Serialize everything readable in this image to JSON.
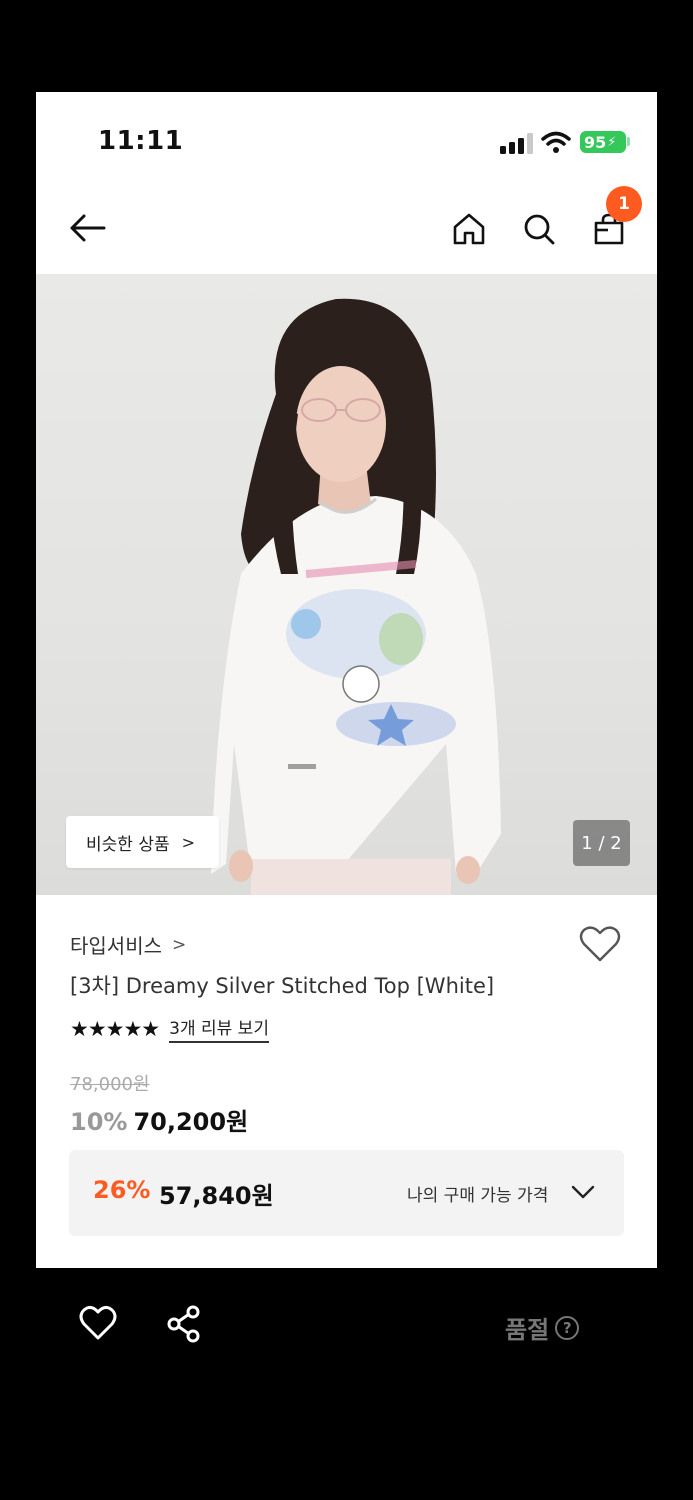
{
  "status_bar": {
    "time": "11:11",
    "battery": "95"
  },
  "header": {
    "cart_count": "1"
  },
  "gallery": {
    "similar_label": "비슷한 상품",
    "page_indicator": "1 / 2"
  },
  "product": {
    "brand": "타입서비스",
    "title": "[3차] Dreamy Silver Stitched Top [White]",
    "stars": "★★★★★",
    "reviews_link": "3개 리뷰 보기",
    "original_price": "78,000원",
    "discount_rate": "10%",
    "price": "70,200원"
  },
  "my_price": {
    "discount_rate": "26%",
    "price": "57,840원",
    "label": "나의 구매 가능 가격"
  },
  "bottom_bar": {
    "status": "품절",
    "help": "?"
  },
  "colors": {
    "accent": "#ff5a1f",
    "battery": "#34c759"
  }
}
